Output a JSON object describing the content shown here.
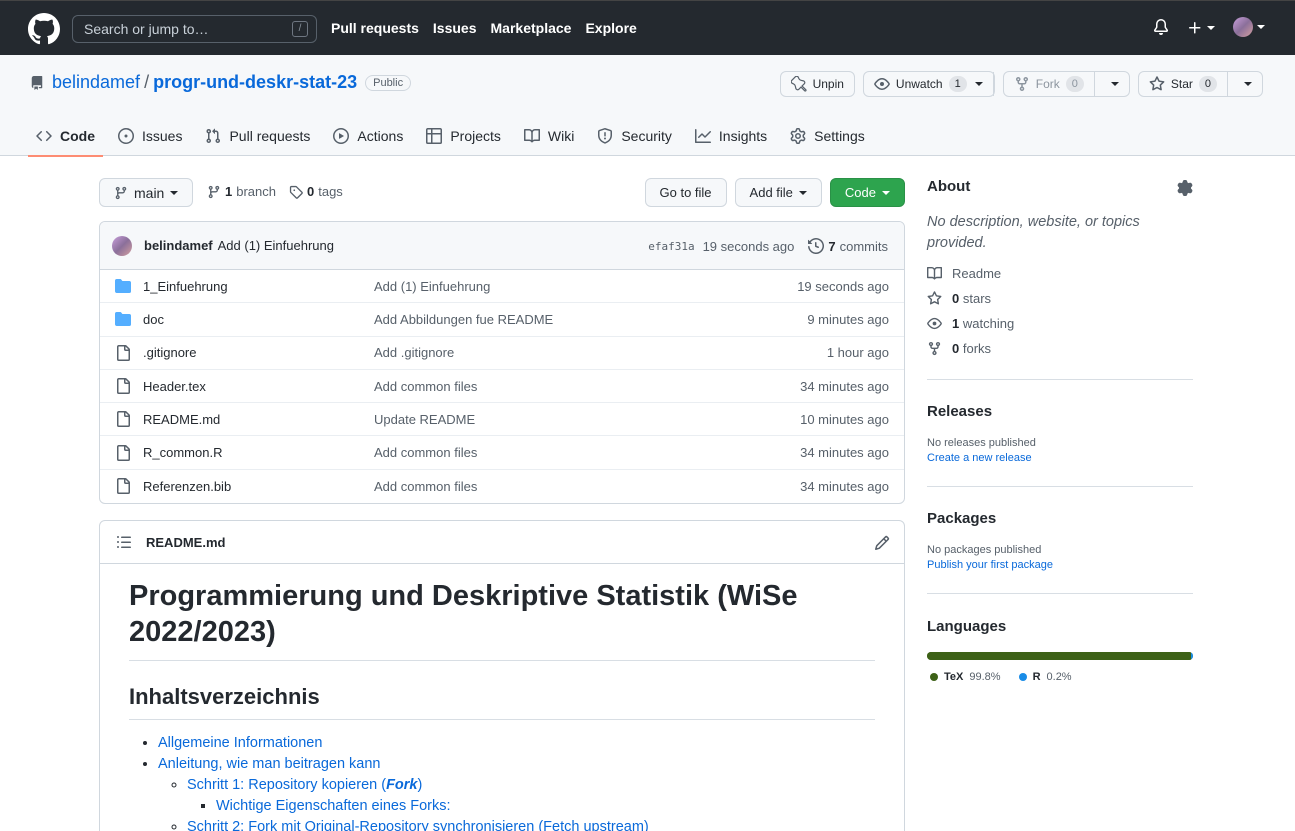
{
  "header": {
    "search_placeholder": "Search or jump to…",
    "search_shortcut": "/",
    "nav": [
      "Pull requests",
      "Issues",
      "Marketplace",
      "Explore"
    ]
  },
  "repo": {
    "owner": "belindamef",
    "name": "progr-und-deskr-stat-23",
    "visibility": "Public",
    "unpin_label": "Unpin",
    "watch_label": "Unwatch",
    "watch_count": "1",
    "fork_label": "Fork",
    "fork_count": "0",
    "star_label": "Star",
    "star_count": "0"
  },
  "tabs": [
    {
      "label": "Code",
      "icon": "code-icon"
    },
    {
      "label": "Issues",
      "icon": "issue-icon"
    },
    {
      "label": "Pull requests",
      "icon": "pull-request-icon"
    },
    {
      "label": "Actions",
      "icon": "play-icon"
    },
    {
      "label": "Projects",
      "icon": "table-icon"
    },
    {
      "label": "Wiki",
      "icon": "book-icon"
    },
    {
      "label": "Security",
      "icon": "shield-icon"
    },
    {
      "label": "Insights",
      "icon": "graph-icon"
    },
    {
      "label": "Settings",
      "icon": "gear-icon"
    }
  ],
  "toolbar": {
    "branch": "main",
    "branch_count": "1",
    "branch_label": "branch",
    "tag_count": "0",
    "tag_label": "tags",
    "goto_file": "Go to file",
    "add_file": "Add file",
    "code": "Code"
  },
  "commit": {
    "author": "belindamef",
    "message": "Add (1) Einfuehrung",
    "sha": "efaf31a",
    "time": "19 seconds ago",
    "count": "7",
    "count_label": "commits"
  },
  "files": [
    {
      "type": "folder",
      "name": "1_Einfuehrung",
      "message": "Add (1) Einfuehrung",
      "age": "19 seconds ago"
    },
    {
      "type": "folder",
      "name": "doc",
      "message": "Add Abbildungen fue README",
      "age": "9 minutes ago"
    },
    {
      "type": "file",
      "name": ".gitignore",
      "message": "Add .gitignore",
      "age": "1 hour ago"
    },
    {
      "type": "file",
      "name": "Header.tex",
      "message": "Add common files",
      "age": "34 minutes ago"
    },
    {
      "type": "file",
      "name": "README.md",
      "message": "Update README",
      "age": "10 minutes ago"
    },
    {
      "type": "file",
      "name": "R_common.R",
      "message": "Add common files",
      "age": "34 minutes ago"
    },
    {
      "type": "file",
      "name": "Referenzen.bib",
      "message": "Add common files",
      "age": "34 minutes ago"
    }
  ],
  "readme": {
    "filename": "README.md",
    "title": "Programmierung und Deskriptive Statistik (WiSe 2022/2023)",
    "toc_heading": "Inhaltsverzeichnis",
    "toc1": "Allgemeine Informationen",
    "toc2": "Anleitung, wie man beitragen kann",
    "toc2_1_pre": "Schritt 1: Repository kopieren (",
    "toc2_1_em": "Fork",
    "toc2_1_post": ")",
    "toc2_1_1": "Wichtige Eigenschaften eines Forks:",
    "toc2_2": "Schritt 2: Fork mit Original-Repository synchronisieren (Fetch upstream)"
  },
  "sidebar": {
    "about_title": "About",
    "about_desc": "No description, website, or topics provided.",
    "readme": "Readme",
    "stars_count": "0",
    "stars_label": "stars",
    "watching_count": "1",
    "watching_label": "watching",
    "forks_count": "0",
    "forks_label": "forks",
    "releases_title": "Releases",
    "releases_none": "No releases published",
    "releases_link": "Create a new release",
    "packages_title": "Packages",
    "packages_none": "No packages published",
    "packages_link": "Publish your first package",
    "languages_title": "Languages",
    "languages": [
      {
        "name": "TeX",
        "percent": "99.8%",
        "color": "#3d6117",
        "share": 99.8
      },
      {
        "name": "R",
        "percent": "0.2%",
        "color": "#198ce7",
        "share": 0.2
      }
    ]
  },
  "colors": {
    "header_bg": "#24292f",
    "link": "#0969da",
    "active_tab": "#fd8c73",
    "code_button": "#2da44e",
    "folder": "#54aeff"
  }
}
